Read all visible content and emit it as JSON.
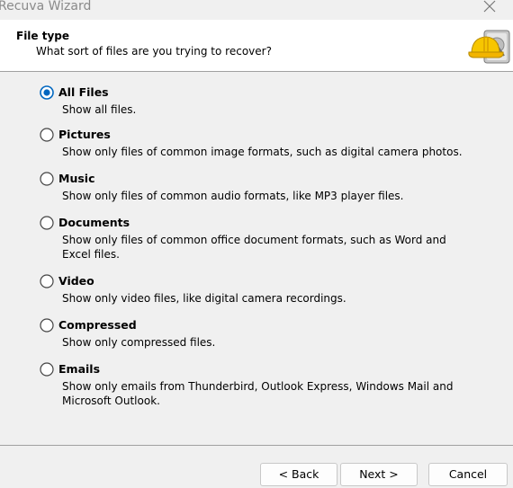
{
  "window": {
    "title": "Recuva Wizard",
    "close_icon": "close-icon"
  },
  "header": {
    "title": "File type",
    "subtitle": "What sort of files are you trying to recover?",
    "icon": "recuva-hardhat-drive-icon"
  },
  "options": [
    {
      "label": "All Files",
      "description": "Show all files.",
      "selected": true
    },
    {
      "label": "Pictures",
      "description": "Show only files of common image formats, such as digital camera photos.",
      "selected": false
    },
    {
      "label": "Music",
      "description": "Show only files of common audio formats, like MP3 player files.",
      "selected": false
    },
    {
      "label": "Documents",
      "description": "Show only files of common office document formats, such as Word and Excel files.",
      "selected": false
    },
    {
      "label": "Video",
      "description": "Show only video files, like digital camera recordings.",
      "selected": false
    },
    {
      "label": "Compressed",
      "description": "Show only compressed files.",
      "selected": false
    },
    {
      "label": "Emails",
      "description": "Show only emails from Thunderbird, Outlook Express, Windows Mail and Microsoft Outlook.",
      "selected": false
    }
  ],
  "buttons": {
    "back": "< Back",
    "next": "Next >",
    "cancel": "Cancel"
  },
  "colors": {
    "accent": "#0067c0",
    "background": "#f0f0f0",
    "header_bg": "#ffffff"
  }
}
